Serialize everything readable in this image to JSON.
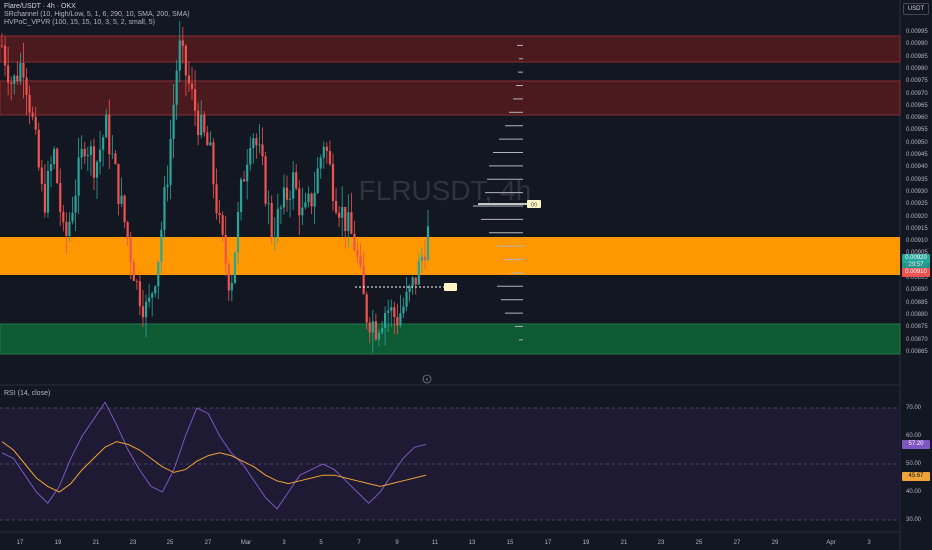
{
  "header": {
    "symbol_line": "Flare/USDT · 4h · OKX",
    "indicator_1": "SRchannel (10, High/Low, 5, 1, 6, 290, 10, SMA, 200, SMA)",
    "indicator_2": "HVPoC_VPVR (100, 15, 15, 10, 3, 5, 2, small, 5)",
    "currency_button": "USDT"
  },
  "watermark": "FLRUSDT, 4h",
  "rsi": {
    "label": "RSI (14, close)",
    "value": "57.20",
    "ma_value": "45.67",
    "levels": [
      "70.00",
      "60.00",
      "50.00",
      "40.00",
      "30.00"
    ]
  },
  "price_axis": {
    "labels": [
      "0.00995",
      "0.00990",
      "0.00985",
      "0.00980",
      "0.00975",
      "0.00970",
      "0.00965",
      "0.00960",
      "0.00955",
      "0.00950",
      "0.00945",
      "0.00940",
      "0.00935",
      "0.00930",
      "0.00925",
      "0.00920",
      "0.00915",
      "0.00910",
      "0.00905",
      "0.00900",
      "0.00895",
      "0.00890",
      "0.00885",
      "0.00880",
      "0.00875",
      "0.00870",
      "0.00865"
    ],
    "last_price": "0.00920",
    "timer": "29:57",
    "prev_label": "0.00910"
  },
  "time_axis": {
    "labels": [
      "17",
      "19",
      "21",
      "23",
      "25",
      "27",
      "Mar",
      "3",
      "5",
      "7",
      "9",
      "11",
      "13",
      "15",
      "17",
      "19",
      "21",
      "23",
      "25",
      "27",
      "29",
      "Apr",
      "3"
    ]
  },
  "markers": {
    "poc_label": "(x)",
    "event_icon": "e"
  },
  "colors": {
    "background": "#131722",
    "resistance_zone": "#4a1a1e",
    "resistance_border": "#8a2d32",
    "support_zone": "#ff9800",
    "low_zone": "#0e5a33",
    "up_candle": "#26a69a",
    "down_candle": "#ef5350",
    "rsi_line": "#7e57c2",
    "rsi_ma": "#f0a336"
  },
  "chart_data": {
    "type": "candlestick",
    "symbol": "FLRUSDT",
    "timeframe": "4h",
    "close_path": [
      0.0099,
      0.00975,
      0.00985,
      0.0096,
      0.0093,
      0.0095,
      0.00915,
      0.00935,
      0.00955,
      0.00945,
      0.0096,
      0.0094,
      0.0092,
      0.009,
      0.0089,
      0.0091,
      0.00945,
      0.0099,
      0.00975,
      0.0096,
      0.0095,
      0.0092,
      0.009,
      0.00935,
      0.0096,
      0.00945,
      0.0092,
      0.0093,
      0.0094,
      0.00925,
      0.00935,
      0.00955,
      0.00935,
      0.00925,
      0.00915,
      0.0089,
      0.00885,
      0.00892,
      0.00888,
      0.00895,
      0.00905,
      0.0092
    ],
    "zones": [
      {
        "name": "resistance-1",
        "from": 0.00985,
        "to": 0.00995
      },
      {
        "name": "resistance-2",
        "from": 0.00965,
        "to": 0.00979
      },
      {
        "name": "support-orange",
        "from": 0.00903,
        "to": 0.00917
      },
      {
        "name": "support-green",
        "from": 0.00876,
        "to": 0.00887
      }
    ],
    "rsi_path": [
      54,
      52,
      46,
      40,
      36,
      42,
      52,
      60,
      66,
      72,
      64,
      55,
      48,
      42,
      40,
      48,
      60,
      70,
      68,
      60,
      54,
      50,
      44,
      38,
      34,
      40,
      46,
      48,
      50,
      48,
      44,
      40,
      36,
      40,
      46,
      52,
      56,
      57
    ],
    "rsi_ma_path": [
      58,
      55,
      50,
      45,
      42,
      40,
      43,
      48,
      52,
      56,
      58,
      57,
      55,
      52,
      49,
      47,
      48,
      51,
      53,
      54,
      53,
      51,
      49,
      46,
      44,
      43,
      44,
      45,
      46,
      46,
      45,
      44,
      43,
      42,
      43,
      44,
      45,
      46
    ]
  }
}
